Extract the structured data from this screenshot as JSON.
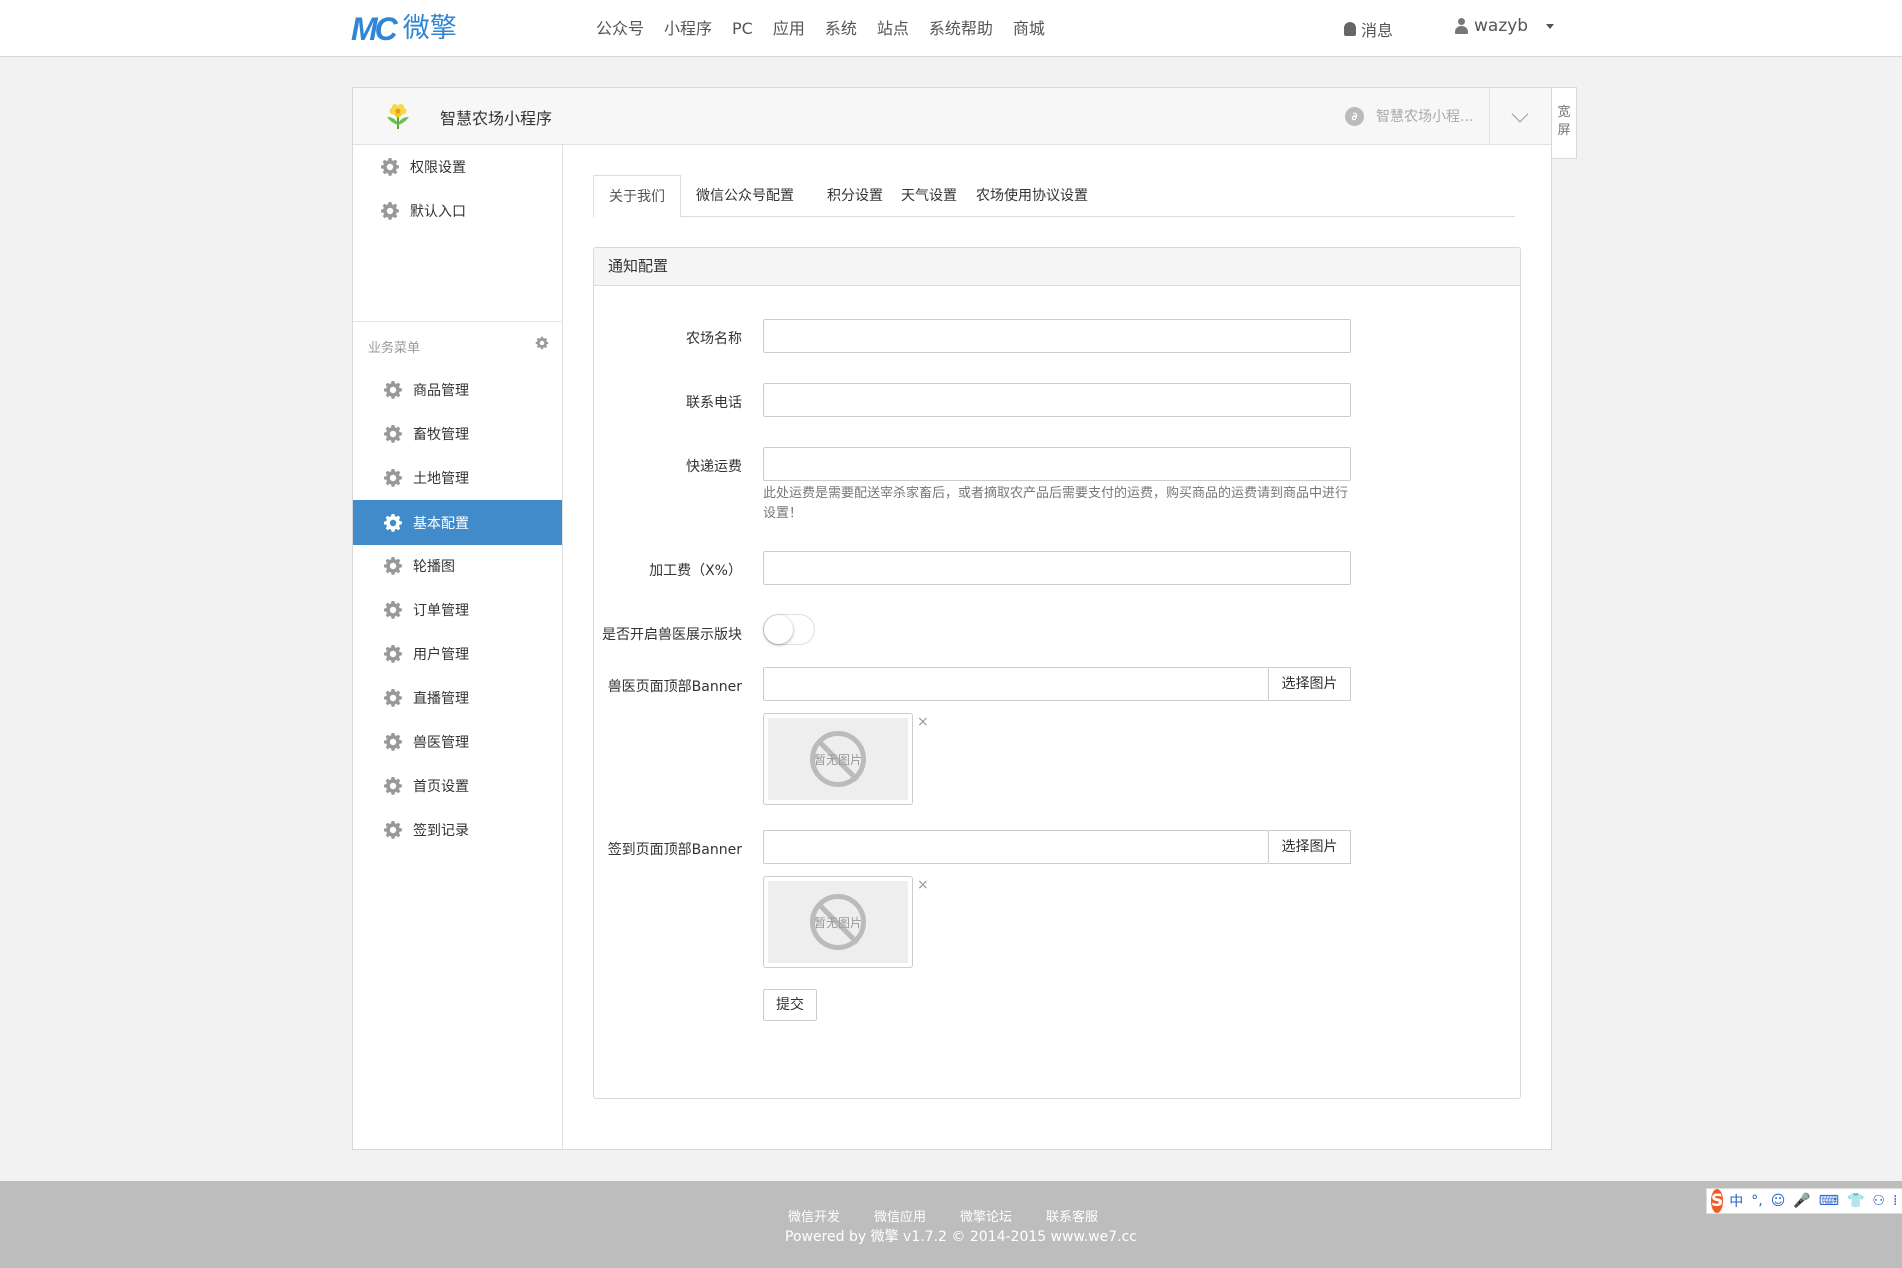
{
  "brand": {
    "logo_mark": "MC",
    "logo_text": "微擎"
  },
  "topnav": [
    "公众号",
    "小程序",
    "PC",
    "应用",
    "系统",
    "站点",
    "系统帮助",
    "商城"
  ],
  "header_right": {
    "messages": "消息",
    "username": "wazyb"
  },
  "panel": {
    "app_name": "智慧农场小程序",
    "switch_label": "智慧农场小程...",
    "wide_screen_label": "宽\n屏"
  },
  "sidebar": {
    "top_items": [
      "权限设置",
      "默认入口"
    ],
    "group_title": "业务菜单",
    "items": [
      "商品管理",
      "畜牧管理",
      "土地管理",
      "基本配置",
      "轮播图",
      "订单管理",
      "用户管理",
      "直播管理",
      "兽医管理",
      "首页设置",
      "签到记录"
    ],
    "active_item": "基本配置"
  },
  "tabs": [
    "关于我们",
    "微信公众号配置",
    "积分设置",
    "天气设置",
    "农场使用协议设置"
  ],
  "form": {
    "section_title": "通知配置",
    "farm_name_label": "农场名称",
    "farm_name_value": "",
    "phone_label": "联系电话",
    "phone_value": "",
    "shipping_label": "快递运费",
    "shipping_value": "",
    "shipping_help": "此处运费是需要配送宰杀家畜后，或者摘取农产品后需要支付的运费，购买商品的运费请到商品中进行设置！",
    "processing_label": "加工费（X%）",
    "processing_value": "",
    "vet_toggle_label": "是否开启兽医展示版块",
    "vet_toggle_on": false,
    "vet_banner_label": "兽医页面顶部Banner",
    "vet_banner_value": "",
    "checkin_banner_label": "签到页面顶部Banner",
    "checkin_banner_value": "",
    "choose_image": "选择图片",
    "no_image": "暂无图片",
    "remove_mark": "×",
    "submit": "提交"
  },
  "footer": {
    "links": [
      "微信开发",
      "微信应用",
      "微擎论坛",
      "联系客服"
    ],
    "copyright": "Powered by 微擎 v1.7.2 © 2014-2015 www.we7.cc"
  },
  "ime": {
    "logo": "S",
    "items": [
      "中",
      "°,",
      "☺",
      "🎤",
      "⌨",
      "👕",
      "⚇",
      "⁞"
    ]
  },
  "colors": {
    "brand": "#2e86d4",
    "active": "#428bca",
    "footer": "#bdbdbd",
    "ime_logo": "#f05a24"
  }
}
